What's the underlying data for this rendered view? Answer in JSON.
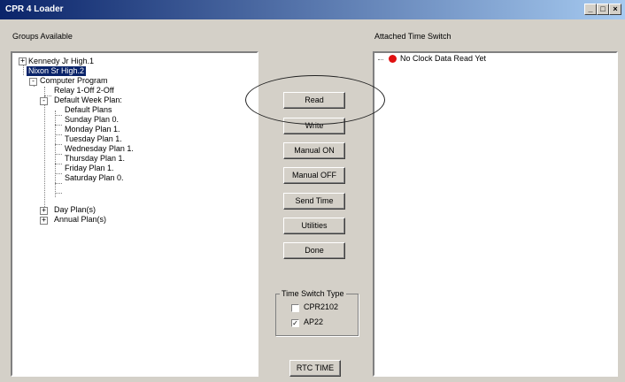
{
  "window": {
    "title": "CPR 4 Loader"
  },
  "labels": {
    "groups_available": "Groups Available",
    "attached_time_switch": "Attached Time Switch"
  },
  "tree": {
    "kennedy": "Kennedy Jr High.1",
    "nixon": "Nixon Sr High.2",
    "computer_program": "Computer Program",
    "relay": "Relay 1-Off 2-Off",
    "default_week_plan": "Default Week Plan:",
    "default_plans": "Default Plans",
    "sunday": "Sunday Plan 0.",
    "monday": "Monday Plan 1.",
    "tuesday": "Tuesday Plan 1.",
    "wednesday": "Wednesday Plan 1.",
    "thursday": "Thursday Plan 1.",
    "friday": "Friday Plan 1.",
    "saturday": "Saturday Plan 0.",
    "day_plans": "Day Plan(s)",
    "annual_plans": "Annual Plan(s)"
  },
  "attached": {
    "status": "No Clock Data Read Yet",
    "status_color": "#e01010"
  },
  "buttons": {
    "read": "Read",
    "write": "Write",
    "manual_on": "Manual ON",
    "manual_off": "Manual OFF",
    "send_time": "Send Time",
    "utilities": "Utilities",
    "done": "Done",
    "rtc_time": "RTC TIME"
  },
  "time_switch_type": {
    "label": "Time Switch Type",
    "options": [
      {
        "label": "CPR2102",
        "checked": false
      },
      {
        "label": "AP22",
        "checked": true
      }
    ]
  }
}
